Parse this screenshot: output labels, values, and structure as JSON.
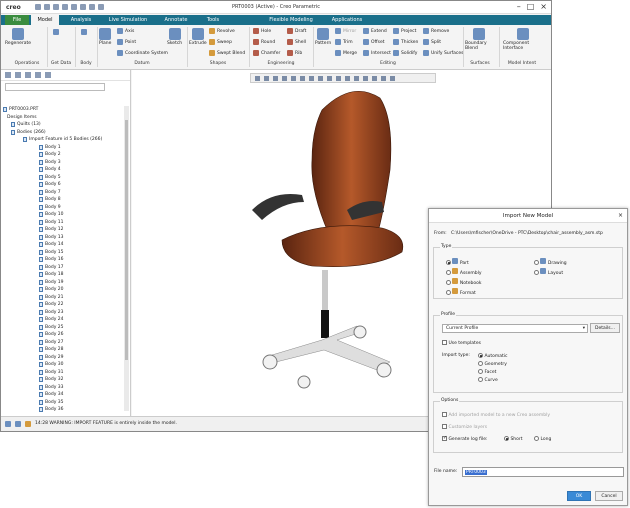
{
  "app": {
    "logo": "creo",
    "title": "PRT0003 (Active) - Creo Parametric"
  },
  "tabs": [
    "File",
    "Model",
    "Analysis",
    "Live Simulation",
    "Annotate",
    "Tools",
    "Flexible Modeling",
    "Applications"
  ],
  "ribbon": {
    "operations": {
      "label": "Operations",
      "regenerate": "Regenerate"
    },
    "getdata": {
      "label": "Get Data"
    },
    "body": {
      "label": "Body"
    },
    "datum": {
      "label": "Datum",
      "axis": "Axis",
      "point": "Point",
      "coord": "Coordinate System",
      "plane": "Plane",
      "sketch": "Sketch"
    },
    "shapes": {
      "label": "Shapes",
      "extrude": "Extrude",
      "revolve": "Revolve",
      "sweep": "Sweep",
      "swept_blend": "Swept Blend"
    },
    "engineering": {
      "label": "Engineering",
      "hole": "Hole",
      "round": "Round",
      "chamfer": "Chamfer",
      "draft": "Draft",
      "shell": "Shell",
      "rib": "Rib"
    },
    "editing": {
      "label": "Editing",
      "pattern": "Pattern",
      "mirror": "Mirror",
      "trim": "Trim",
      "merge": "Merge",
      "extend": "Extend",
      "offset": "Offset",
      "intersect": "Intersect",
      "project": "Project",
      "thicken": "Thicken",
      "solidify": "Solidify",
      "remove": "Remove",
      "split": "Split",
      "unify": "Unify Surfaces"
    },
    "surfaces": {
      "label": "Surfaces",
      "boundary": "Boundary Blend"
    },
    "model_intent": {
      "label": "Model Intent",
      "component": "Component Interface"
    }
  },
  "tree": {
    "root": "PRT0003.PRT",
    "design": "Design Items",
    "quilts": "Quilts (13)",
    "bodies": "Bodies (266)",
    "import": "Import Feature id 5 Bodies (266)",
    "items": [
      "Body 1",
      "Body 2",
      "Body 3",
      "Body 4",
      "Body 5",
      "Body 6",
      "Body 7",
      "Body 8",
      "Body 9",
      "Body 10",
      "Body 11",
      "Body 12",
      "Body 13",
      "Body 14",
      "Body 15",
      "Body 16",
      "Body 17",
      "Body 18",
      "Body 19",
      "Body 20",
      "Body 21",
      "Body 22",
      "Body 23",
      "Body 24",
      "Body 25",
      "Body 26",
      "Body 27",
      "Body 28",
      "Body 29",
      "Body 30",
      "Body 31",
      "Body 32",
      "Body 33",
      "Body 34",
      "Body 35",
      "Body 36"
    ]
  },
  "status": {
    "text": "14:28 WARNING: IMPORT FEATURE is entirely inside the model."
  },
  "colors": {
    "tabbar": "#1a6f8a",
    "file_tab": "#3a8c3f",
    "seat": "#8b3e1f",
    "ok_button": "#3a8ad6"
  },
  "dialog": {
    "title": "Import New Model",
    "from_label": "From:",
    "from_path": "C:\\Users\\mfischer\\OneDrive - PTC\\Desktop\\chair_assembly_asm.stp",
    "type_label": "Type",
    "types": [
      {
        "label": "Part",
        "on": true
      },
      {
        "label": "Assembly",
        "on": false
      },
      {
        "label": "Notebook",
        "on": false
      },
      {
        "label": "Format",
        "on": false
      },
      {
        "label": "Drawing",
        "on": false
      },
      {
        "label": "Layout",
        "on": false
      }
    ],
    "profile_label": "Profile",
    "profile_value": "Current Profile",
    "details": "Details...",
    "use_templates": "Use templates",
    "import_type_label": "Import type:",
    "import_types": [
      {
        "label": "Automatic",
        "on": true
      },
      {
        "label": "Geometry",
        "on": false
      },
      {
        "label": "Facet",
        "on": false
      },
      {
        "label": "Curve",
        "on": false
      }
    ],
    "options_label": "Options",
    "opt_add": "Add imported model to a new Creo assembly",
    "opt_customize": "Customize layers",
    "opt_log": "Generate log file:",
    "log_short": "Short",
    "log_long": "Long",
    "filename_label": "File name:",
    "filename": "PRT0003",
    "ok": "OK",
    "cancel": "Cancel"
  }
}
